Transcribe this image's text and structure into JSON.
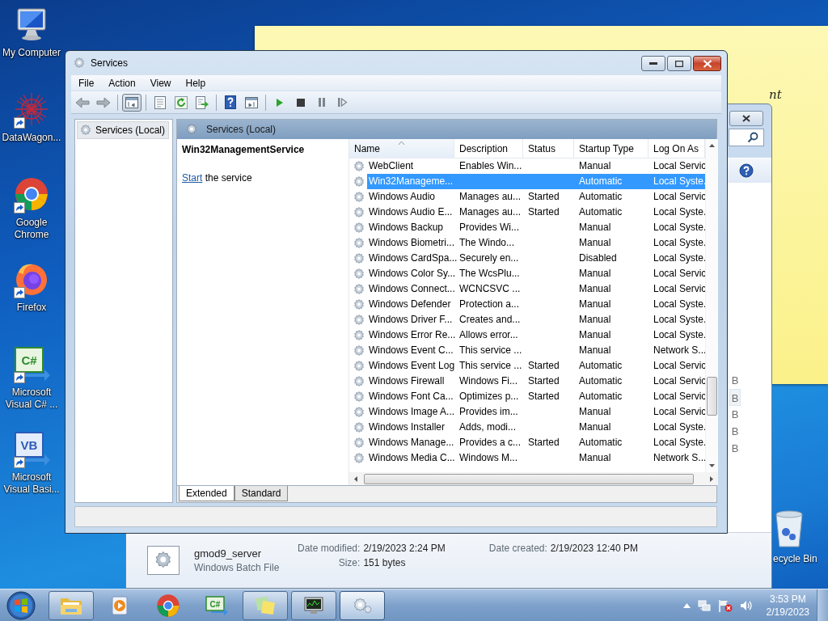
{
  "desktop_icons": [
    {
      "kind": "computer",
      "label": "My Computer",
      "shortcut": false
    },
    {
      "kind": "starburst",
      "label": "DataWagon...",
      "shortcut": true
    },
    {
      "kind": "chrome",
      "label": "Google Chrome",
      "shortcut": true
    },
    {
      "kind": "firefox",
      "label": "Firefox",
      "shortcut": true
    },
    {
      "kind": "csharp",
      "label": "Microsoft Visual C# ...",
      "shortcut": true,
      "logo_text": "C#"
    },
    {
      "kind": "vb",
      "label": "Microsoft Visual Basi...",
      "shortcut": true,
      "logo_text": "VB"
    }
  ],
  "recycle_bin": {
    "label": "ecycle Bin"
  },
  "sticky_note": {
    "text": "nt"
  },
  "explorer_window": {
    "size_cells": [
      {
        "text": "B",
        "highlighted": false
      },
      {
        "text": "B",
        "highlighted": true
      },
      {
        "text": "B",
        "highlighted": false
      },
      {
        "text": "B",
        "highlighted": false
      },
      {
        "text": "B",
        "highlighted": false
      }
    ],
    "details": {
      "name": "gmod9_server",
      "type": "Windows Batch File",
      "field_groups": [
        [
          {
            "label": "Date modified:",
            "value": "2/19/2023 2:24 PM"
          },
          {
            "label": "Size:",
            "value": "151 bytes"
          }
        ],
        [
          {
            "label": "Date created:",
            "value": "2/19/2023 12:40 PM"
          }
        ]
      ]
    }
  },
  "services_window": {
    "title": "Services",
    "menu": [
      "File",
      "Action",
      "View",
      "Help"
    ],
    "toolbar": [
      {
        "kind": "back",
        "selected": false
      },
      {
        "kind": "forward",
        "selected": false
      },
      {
        "kind": "console-tree",
        "selected": true
      },
      {
        "kind": "properties",
        "selected": false
      },
      {
        "kind": "refresh",
        "selected": false
      },
      {
        "kind": "export",
        "selected": false
      },
      {
        "kind": "help",
        "selected": false
      },
      {
        "kind": "action-pane",
        "selected": false
      },
      {
        "kind": "play",
        "selected": false
      },
      {
        "kind": "stop",
        "selected": false
      },
      {
        "kind": "pause",
        "selected": false
      },
      {
        "kind": "resume",
        "selected": false
      }
    ],
    "tree": [
      {
        "label": "Services (Local)",
        "selected": true
      }
    ],
    "pane_title": "Services (Local)",
    "description": {
      "title": "Win32ManagementService",
      "link": "Start",
      "text": " the service"
    },
    "columns": [
      {
        "label": "Name",
        "sorted": true
      },
      {
        "label": "Description",
        "sorted": false
      },
      {
        "label": "Status",
        "sorted": false
      },
      {
        "label": "Startup Type",
        "sorted": false
      },
      {
        "label": "Log On As",
        "sorted": false
      }
    ],
    "rows": [
      {
        "name": "WebClient",
        "description": "Enables Win...",
        "startup": "Manual",
        "logon": "Local Servic",
        "selected": false
      },
      {
        "name": "Win32Manageme...",
        "startup": "Automatic",
        "logon": "Local Syste.",
        "selected": true
      },
      {
        "name": "Windows Audio",
        "description": "Manages au...",
        "status": "Started",
        "startup": "Automatic",
        "logon": "Local Servic",
        "selected": false
      },
      {
        "name": "Windows Audio E...",
        "description": "Manages au...",
        "status": "Started",
        "startup": "Automatic",
        "logon": "Local Syste.",
        "selected": false
      },
      {
        "name": "Windows Backup",
        "description": "Provides Wi...",
        "startup": "Manual",
        "logon": "Local Syste.",
        "selected": false
      },
      {
        "name": "Windows Biometri...",
        "description": "The Windo...",
        "startup": "Manual",
        "logon": "Local Syste.",
        "selected": false
      },
      {
        "name": "Windows CardSpa...",
        "description": "Securely en...",
        "startup": "Disabled",
        "logon": "Local Syste.",
        "selected": false
      },
      {
        "name": "Windows Color Sy...",
        "description": "The WcsPlu...",
        "startup": "Manual",
        "logon": "Local Servic",
        "selected": false
      },
      {
        "name": "Windows Connect...",
        "description": "WCNCSVC ...",
        "startup": "Manual",
        "logon": "Local Servic",
        "selected": false
      },
      {
        "name": "Windows Defender",
        "description": "Protection a...",
        "startup": "Manual",
        "logon": "Local Syste.",
        "selected": false
      },
      {
        "name": "Windows Driver F...",
        "description": "Creates and...",
        "startup": "Manual",
        "logon": "Local Syste.",
        "selected": false
      },
      {
        "name": "Windows Error Re...",
        "description": "Allows error...",
        "startup": "Manual",
        "logon": "Local Syste.",
        "selected": false
      },
      {
        "name": "Windows Event C...",
        "description": "This service ...",
        "startup": "Manual",
        "logon": "Network S...",
        "selected": false
      },
      {
        "name": "Windows Event Log",
        "description": "This service ...",
        "status": "Started",
        "startup": "Automatic",
        "logon": "Local Servic",
        "selected": false
      },
      {
        "name": "Windows Firewall",
        "description": "Windows Fi...",
        "status": "Started",
        "startup": "Automatic",
        "logon": "Local Servic",
        "selected": false
      },
      {
        "name": "Windows Font Ca...",
        "description": "Optimizes p...",
        "status": "Started",
        "startup": "Automatic",
        "logon": "Local Servic",
        "selected": false
      },
      {
        "name": "Windows Image A...",
        "description": "Provides im...",
        "startup": "Manual",
        "logon": "Local Servic",
        "selected": false
      },
      {
        "name": "Windows Installer",
        "description": "Adds, modi...",
        "startup": "Manual",
        "logon": "Local Syste.",
        "selected": false
      },
      {
        "name": "Windows Manage...",
        "description": "Provides a c...",
        "status": "Started",
        "startup": "Automatic",
        "logon": "Local Syste.",
        "selected": false
      },
      {
        "name": "Windows Media C...",
        "description": "Windows M...",
        "startup": "Manual",
        "logon": "Network S...",
        "selected": false
      }
    ],
    "tabs": [
      {
        "label": "Extended",
        "selected": true
      },
      {
        "label": "Standard",
        "selected": false
      }
    ]
  },
  "taskbar": {
    "buttons": [
      {
        "kind": "explorer",
        "open": true,
        "selected": false
      },
      {
        "kind": "media",
        "open": false,
        "selected": false
      },
      {
        "kind": "chrome",
        "open": false,
        "selected": false
      },
      {
        "kind": "csharp",
        "open": false,
        "selected": false,
        "logo_text": "C#"
      },
      {
        "kind": "sticky",
        "open": true,
        "selected": false
      },
      {
        "kind": "monitor",
        "open": true,
        "selected": false
      },
      {
        "kind": "services",
        "open": true,
        "selected": true
      }
    ],
    "clock_time": "3:53 PM",
    "clock_date": "2/19/2023"
  }
}
